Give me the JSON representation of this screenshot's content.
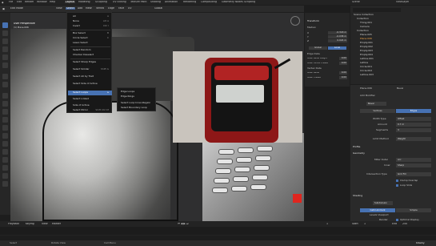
{
  "topbar": {
    "menus": [
      "File",
      "Edit",
      "Render",
      "Window",
      "Help"
    ],
    "workspaces": [
      "Layout",
      "Modeling",
      "Sculpting",
      "UV Editing",
      "Texture Paint",
      "Shading",
      "Animation",
      "Rendering",
      "Compositing",
      "Geometry Nodes",
      "Scripting"
    ],
    "active_workspace": "Layout",
    "scene": "Scene",
    "viewlayer": "ViewLayer"
  },
  "header": {
    "mode": "Edit Mode",
    "menus": [
      "View",
      "Select",
      "Add",
      "Mesh",
      "Vertex",
      "Edge",
      "Face",
      "UV"
    ],
    "active_menu": "Select",
    "transform": "Global"
  },
  "viewport": {
    "overlay_title": "User Perspective",
    "overlay_subtitle": "(1) Plane.006"
  },
  "select_menu": {
    "items": [
      {
        "label": "All",
        "shortcut": "A"
      },
      {
        "label": "None",
        "shortcut": "Alt A"
      },
      {
        "label": "Invert",
        "shortcut": "Ctrl I"
      },
      {
        "label": "Box Select",
        "shortcut": "B"
      },
      {
        "label": "Circle Select",
        "shortcut": "C"
      },
      {
        "label": "Lasso Select",
        "shortcut": ""
      },
      {
        "label": "Select Random",
        "shortcut": ""
      },
      {
        "label": "Checker Deselect",
        "shortcut": ""
      },
      {
        "label": "Select Sharp Edges",
        "shortcut": ""
      },
      {
        "label": "Select Similar",
        "shortcut": "Shift G"
      },
      {
        "label": "Select All by Trait",
        "shortcut": ""
      },
      {
        "label": "Select Side of Active",
        "shortcut": ""
      },
      {
        "label": "Select Loops",
        "shortcut": ""
      },
      {
        "label": "Select Linked",
        "shortcut": ""
      },
      {
        "label": "Side of Active",
        "shortcut": ""
      },
      {
        "label": "Select Mirror",
        "shortcut": "Shift Ctrl M"
      }
    ],
    "highlighted": "Select Loops"
  },
  "submenu": {
    "items": [
      "Edge Loops",
      "Edge Rings",
      "Select Loop Inner-Region",
      "Select Boundary Loop"
    ]
  },
  "npanel": {
    "title": "Transform",
    "section": "Median",
    "fields": [
      {
        "label": "X",
        "value": "-0.318 m"
      },
      {
        "label": "Y",
        "value": "-0.038 m"
      },
      {
        "label": "Z",
        "value": "0.024 m"
      }
    ],
    "toggle_global": "Global",
    "toggle_local": "Local",
    "edge_data_label": "Edge Data",
    "edge_fields": [
      {
        "label": "Mean Bevel Weight",
        "value": "0.00"
      },
      {
        "label": "Mean Vertex Crease",
        "value": "0.00"
      }
    ],
    "vertex_data_label": "Vertex Data",
    "vertex_fields": [
      {
        "label": "Mean Bevel",
        "value": "0.00"
      },
      {
        "label": "Mean Crease",
        "value": "0.00"
      }
    ]
  },
  "outliner": {
    "rows": [
      "Scene Collection",
      "Collection",
      "Thing.001",
      "Camera",
      "Collection",
      "Plane.005",
      "Plane.006",
      "Empty.001",
      "Empty.002",
      "Empty.003",
      "Empty.004",
      "Lattice.001",
      "Lattice",
      "Circle.001",
      "Circle.002",
      "Lattice.003"
    ]
  },
  "props": {
    "object_name": "Plane.006",
    "modifier_label": "Bevel",
    "add_modifier": "Add Modifier",
    "mod_name": "Bevel",
    "tab_vertices": "Vertices",
    "tab_edges": "Edges",
    "width_type_label": "Width Type",
    "width_type": "Offset",
    "amount_label": "Amount",
    "amount": "0.7 m",
    "segments_label": "Segments",
    "segments": "3",
    "limit_method_label": "Limit Method",
    "limit_method": "Weight",
    "profile_label": "Profile",
    "geometry_label": "Geometry",
    "miter_outer_label": "Miter Outer",
    "miter_outer": "Arc",
    "inner_label": "Inner",
    "inner": "Sharp",
    "intersection_label": "Intersection Type",
    "intersection": "Grid Fill",
    "clamp_label": "Clamp Overlap",
    "loop_slide_label": "Loop Slide",
    "shading_label": "Shading",
    "subdiv_label": "Subdivision",
    "catmull": "Catmull-Clark",
    "simple": "Simple",
    "levels_label": "Levels Viewport",
    "render_label": "Render",
    "optimal_label": "Optimal Display"
  },
  "timeline": {
    "menus": [
      "Playback",
      "Keying",
      "View",
      "Marker"
    ],
    "start_label": "Start",
    "start": "1",
    "end_label": "End",
    "end": "250",
    "frame": "1"
  },
  "status": {
    "items": [
      "Select",
      "Rotate View",
      "Call Menu"
    ],
    "right": "Udemy"
  },
  "colors": {
    "accent": "#4772b3",
    "background": "#1d1d1d",
    "panel": "#2a2a2a"
  }
}
